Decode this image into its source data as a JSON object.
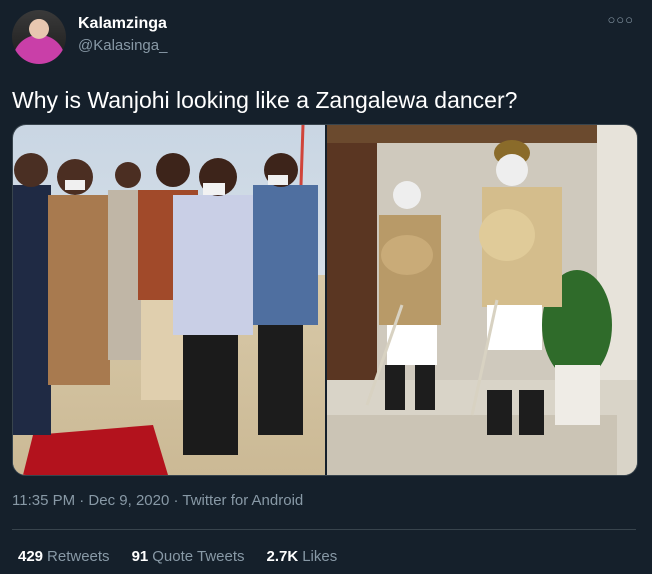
{
  "author": {
    "name": "Kalamzinga",
    "handle": "@Kalasinga_"
  },
  "menu_icon": "more-options-icon",
  "tweet": {
    "text": "Why is Wanjohi looking like a Zangalewa dancer?",
    "timestamp": "11:35 PM · Dec 9, 2020 · Twitter for Android"
  },
  "media": [
    {
      "name": "photo-left"
    },
    {
      "name": "photo-right"
    }
  ],
  "stats": [
    {
      "count": "429",
      "label": "Retweets"
    },
    {
      "count": "91",
      "label": "Quote Tweets"
    },
    {
      "count": "2.7K",
      "label": "Likes"
    }
  ]
}
